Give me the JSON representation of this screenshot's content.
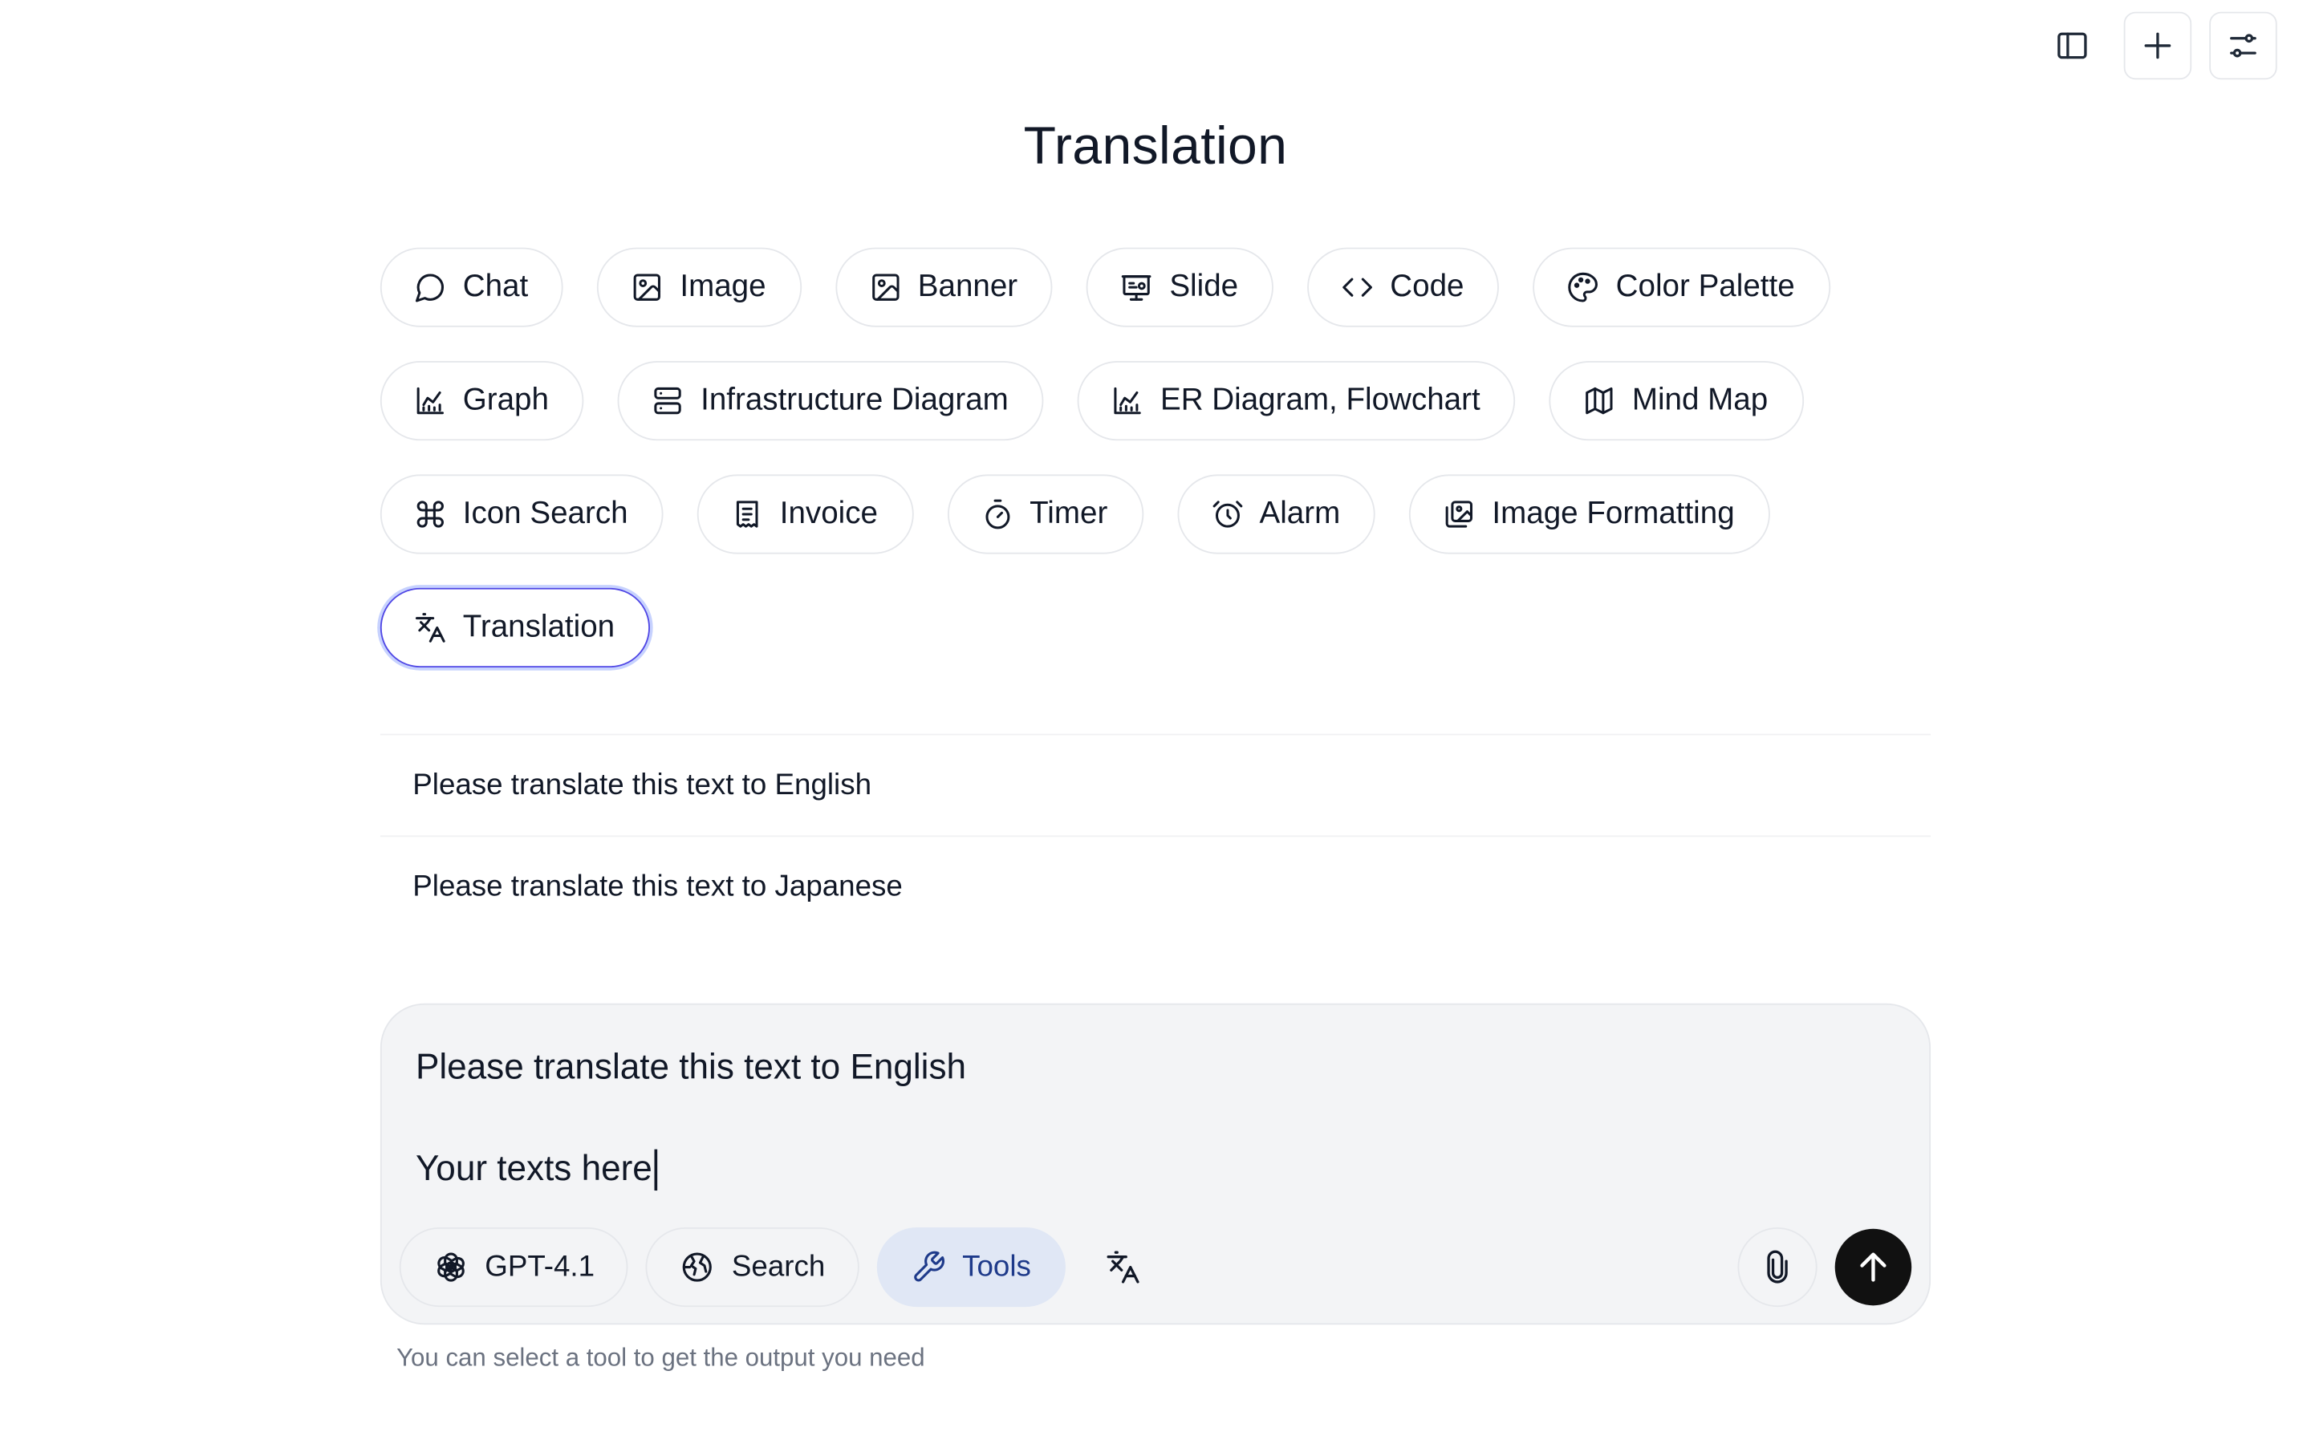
{
  "header": {
    "sidebar_toggle_icon": "sidebar-panel-icon",
    "new_chat_icon": "plus-icon",
    "settings_icon": "sliders-icon"
  },
  "page": {
    "title": "Translation"
  },
  "tools": {
    "rows": [
      [
        {
          "label": "Chat",
          "icon": "message-circle-icon"
        },
        {
          "label": "Image",
          "icon": "image-icon"
        },
        {
          "label": "Banner",
          "icon": "image-icon"
        },
        {
          "label": "Slide",
          "icon": "presentation-icon"
        },
        {
          "label": "Code",
          "icon": "code-icon"
        },
        {
          "label": "Color Palette",
          "icon": "palette-icon"
        }
      ],
      [
        {
          "label": "Graph",
          "icon": "chart-line-icon"
        },
        {
          "label": "Infrastructure Diagram",
          "icon": "server-icon"
        },
        {
          "label": "ER Diagram, Flowchart",
          "icon": "chart-line-icon"
        },
        {
          "label": "Mind Map",
          "icon": "map-icon"
        }
      ],
      [
        {
          "label": "Icon Search",
          "icon": "command-icon"
        },
        {
          "label": "Invoice",
          "icon": "receipt-icon"
        },
        {
          "label": "Timer",
          "icon": "timer-icon"
        },
        {
          "label": "Alarm",
          "icon": "alarm-clock-icon"
        },
        {
          "label": "Image Formatting",
          "icon": "images-icon"
        }
      ],
      [
        {
          "label": "Translation",
          "icon": "languages-icon",
          "active": true
        }
      ]
    ]
  },
  "suggestions": [
    "Please translate this text to English",
    "Please translate this text to Japanese"
  ],
  "composer": {
    "line1": "Please translate this text to English",
    "line2": "Your texts here",
    "model_label": "GPT-4.1",
    "search_label": "Search",
    "tools_label": "Tools"
  },
  "hint": "You can select a tool to get the output you need",
  "colors": {
    "accent": "#4f46e5",
    "tools_bg": "#e0e7f5",
    "tools_text": "#1e3a8a",
    "send_bg": "#111111"
  }
}
